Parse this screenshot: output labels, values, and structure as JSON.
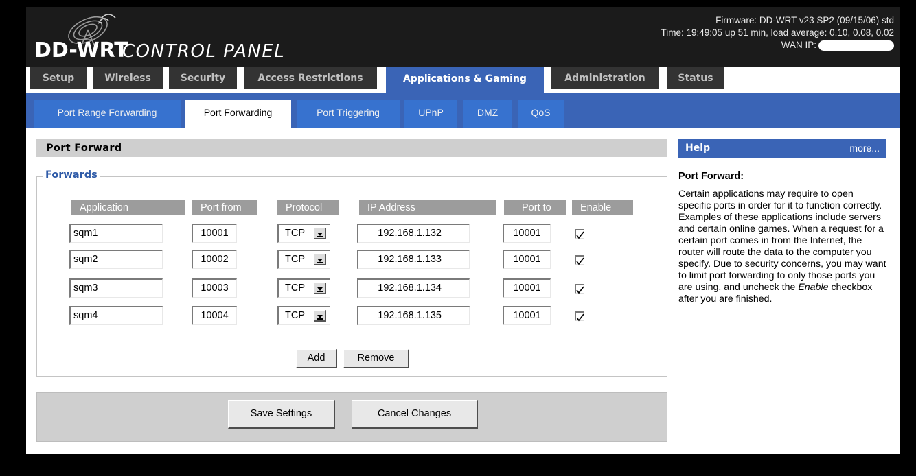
{
  "header": {
    "logo_text": "DD-WRT CONTROL PANEL",
    "firmware": "Firmware: DD-WRT v23 SP2 (09/15/06) std",
    "time": "Time: 19:49:05 up 51 min, load average: 0.10, 0.08, 0.02",
    "wan_label": "WAN IP:"
  },
  "main_tabs": [
    "Setup",
    "Wireless",
    "Security",
    "Access Restrictions",
    "Applications & Gaming",
    "Administration",
    "Status"
  ],
  "sub_tabs": [
    "Port Range Forwarding",
    "Port Forwarding",
    "Port Triggering",
    "UPnP",
    "DMZ",
    "QoS"
  ],
  "section": {
    "title": "Port Forward",
    "legend": "Forwards",
    "columns": [
      "Application",
      "Port from",
      "Protocol",
      "IP Address",
      "Port to",
      "Enable"
    ]
  },
  "rows": [
    {
      "app": "sqm1",
      "port_from": "10001",
      "protocol": "TCP",
      "ip": "192.168.1.132",
      "port_to": "10001",
      "enabled": true
    },
    {
      "app": "sqm2",
      "port_from": "10002",
      "protocol": "TCP",
      "ip": "192.168.1.133",
      "port_to": "10001",
      "enabled": true
    },
    {
      "app": "sqm3",
      "port_from": "10003",
      "protocol": "TCP",
      "ip": "192.168.1.134",
      "port_to": "10001",
      "enabled": true
    },
    {
      "app": "sqm4",
      "port_from": "10004",
      "protocol": "TCP",
      "ip": "192.168.1.135",
      "port_to": "10001",
      "enabled": true
    }
  ],
  "buttons": {
    "add": "Add",
    "remove": "Remove",
    "save": "Save Settings",
    "cancel": "Cancel Changes"
  },
  "help": {
    "title": "Help",
    "more": "more...",
    "topic": "Port Forward:",
    "text_before": "Certain applications may require to open specific ports in order for it to function correctly. Examples of these applications include servers and certain online games. When a request for a certain port comes in from the Internet, the router will route the data to the computer you specify. Due to security concerns, you may want to limit port forwarding to only those ports you are using, and uncheck the ",
    "text_em": "Enable",
    "text_after": " checkbox after you are finished."
  },
  "colors": {
    "accent": "#3a64b6",
    "subtab": "#3772cf",
    "header_bg": "#1b1b1b",
    "legend": "#2f5ba8"
  },
  "icons": [
    "antenna-logo-icon",
    "chevron-down-icon",
    "checkmark-icon"
  ]
}
